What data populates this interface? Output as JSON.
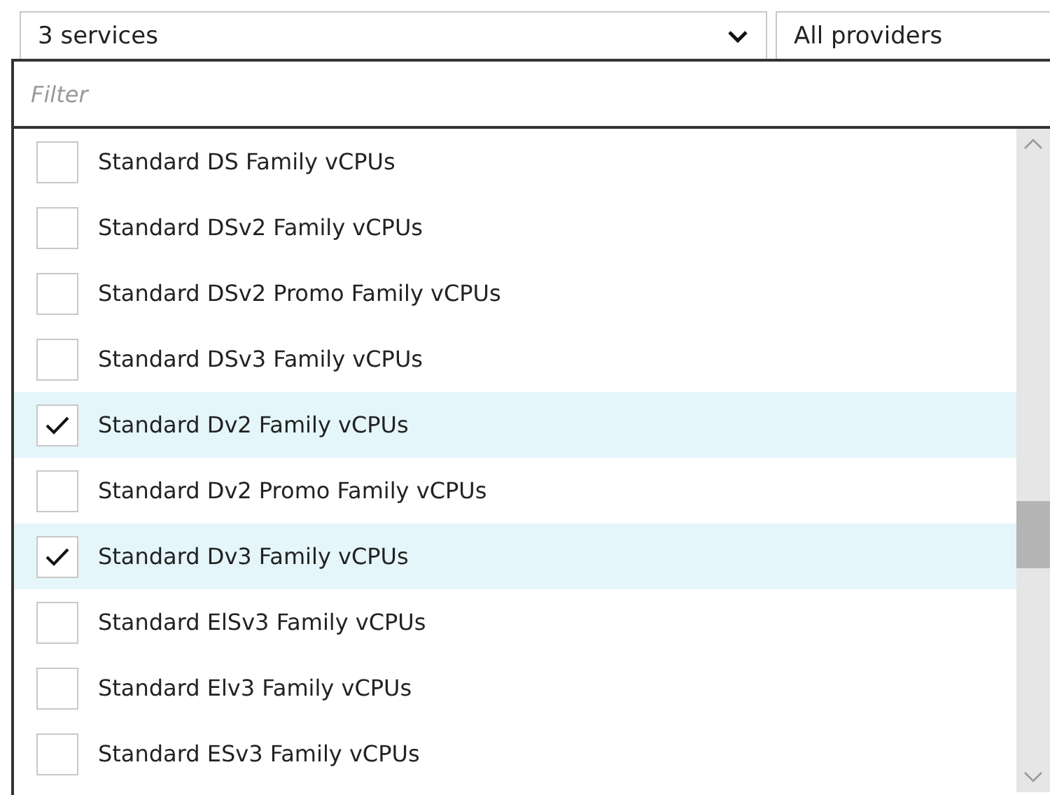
{
  "service_dropdown": {
    "value": "3 services"
  },
  "provider_dropdown": {
    "value": "All providers"
  },
  "filter": {
    "placeholder": "Filter"
  },
  "services": [
    {
      "label": "Standard DS Family vCPUs",
      "checked": false
    },
    {
      "label": "Standard DSv2 Family vCPUs",
      "checked": false
    },
    {
      "label": "Standard DSv2 Promo Family vCPUs",
      "checked": false
    },
    {
      "label": "Standard DSv3 Family vCPUs",
      "checked": false
    },
    {
      "label": "Standard Dv2 Family vCPUs",
      "checked": true
    },
    {
      "label": "Standard Dv2 Promo Family vCPUs",
      "checked": false
    },
    {
      "label": "Standard Dv3 Family vCPUs",
      "checked": true
    },
    {
      "label": "Standard ElSv3 Family vCPUs",
      "checked": false
    },
    {
      "label": "Standard Elv3 Family vCPUs",
      "checked": false
    },
    {
      "label": "Standard ESv3 Family vCPUs",
      "checked": false
    }
  ]
}
